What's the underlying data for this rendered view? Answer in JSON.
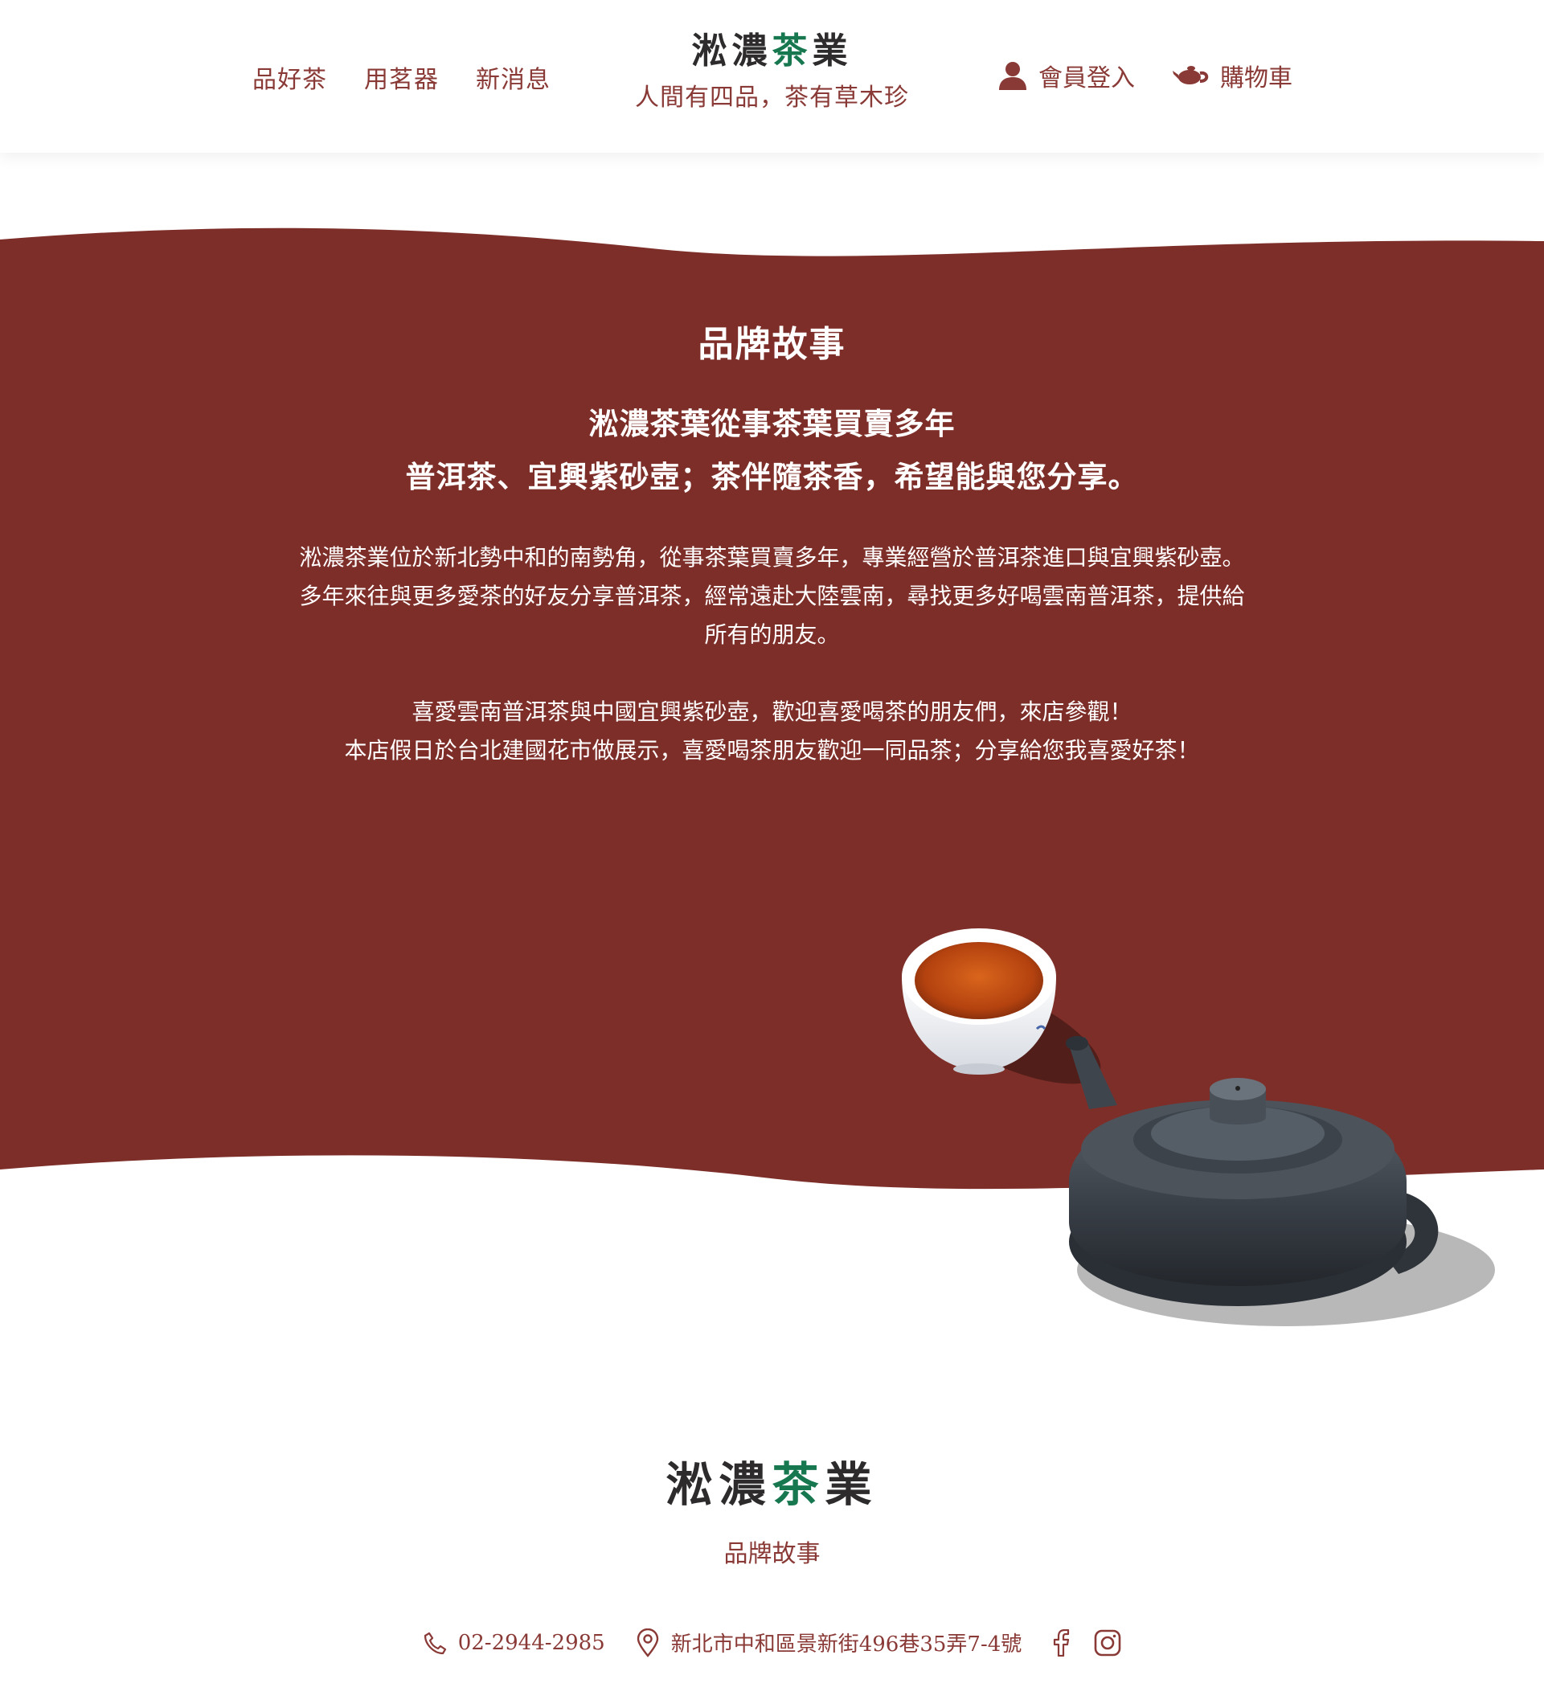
{
  "header": {
    "nav_left": [
      "品好茶",
      "用茗器",
      "新消息"
    ],
    "brand": {
      "part1": "淞濃",
      "accent": "茶",
      "part2": "業"
    },
    "slogan": "人間有四品，茶有草木珍",
    "member_login": "會員登入",
    "cart": "購物車",
    "icons": {
      "member": "user-icon",
      "cart": "teapot-icon"
    }
  },
  "story": {
    "title": "品牌故事",
    "lead": [
      "淞濃茶葉從事茶葉買賣多年",
      "普洱茶、宜興紫砂壺；茶伴隨茶香，希望能與您分享。"
    ],
    "body1": [
      "淞濃茶業位於新北勢中和的南勢角，從事茶葉買賣多年，專業經營於普洱茶進口與宜興紫砂壺。",
      "多年來往與更多愛茶的好友分享普洱茶，經常遠赴大陸雲南，尋找更多好喝雲南普洱茶，提供給",
      "所有的朋友。"
    ],
    "body2": [
      "喜愛雲南普洱茶與中國宜興紫砂壺，歡迎喜愛喝茶的朋友們，來店參觀！",
      "本店假日於台北建國花市做展示，喜愛喝茶朋友歡迎一同品茶；分享給您我喜愛好茶！"
    ]
  },
  "footer": {
    "brand": {
      "part1": "淞濃",
      "accent": "茶",
      "part2": "業"
    },
    "link": "品牌故事",
    "phone": "02-2944-2985",
    "address": "新北市中和區景新街496巷35弄7-4號",
    "icons": {
      "phone": "phone-icon",
      "location": "location-pin-icon",
      "facebook": "facebook-icon",
      "instagram": "instagram-icon"
    }
  },
  "colors": {
    "brand_red": "#7e2e28",
    "text_red": "#8a3a36",
    "accent_green": "#17774f",
    "dark": "#2d2b2b"
  }
}
